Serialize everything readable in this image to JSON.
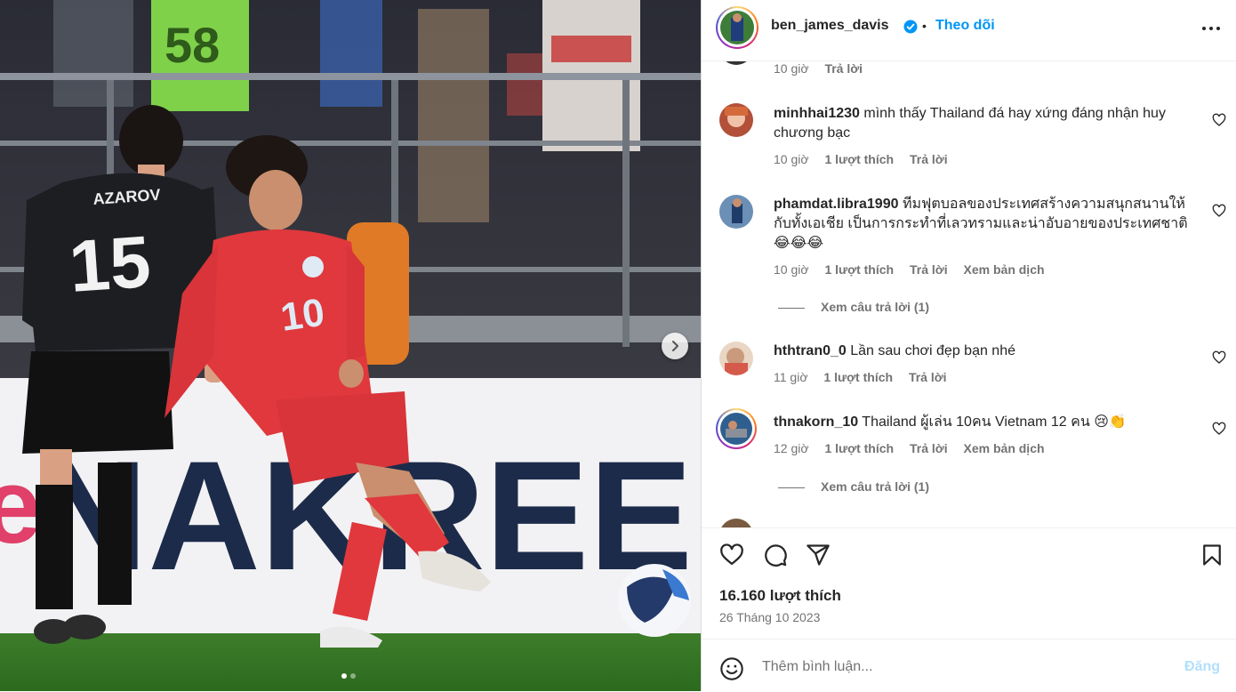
{
  "post": {
    "username": "ben_james_davis",
    "separator": "•",
    "follow_label": "Theo dõi",
    "likes": "16.160 lượt thích",
    "date": "26 Tháng 10 2023",
    "slides_total": 2,
    "slide_active": 1
  },
  "photo": {
    "player_left_name": "AZAROV",
    "player_left_number": "15",
    "player_right_number": "10",
    "stand_bib_number": "58",
    "banner_text": "NAKREE"
  },
  "comments": [
    {
      "user": "",
      "text": "",
      "time": "10 giờ",
      "likes": "",
      "reply": "Trả lời",
      "translate": ""
    },
    {
      "user": "minhhai1230",
      "text": "mình thấy Thailand đá hay xứng đáng nhận huy chương bạc",
      "time": "10 giờ",
      "likes": "1 lượt thích",
      "reply": "Trả lời",
      "translate": ""
    },
    {
      "user": "phamdat.libra1990",
      "text": "ทีมฟุตบอลของประเทศสร้างความสนุกสนานให้กับทั้งเอเชีย เป็นการกระทำที่เลวทรามและน่าอับอายของประเทศชาติ 😂😂😂",
      "time": "10 giờ",
      "likes": "1 lượt thích",
      "reply": "Trả lời",
      "translate": "Xem bản dịch",
      "view_replies": "Xem câu trả lời (1)"
    },
    {
      "user": "hthtran0_0",
      "text": "Lần sau chơi đẹp bạn nhé",
      "time": "11 giờ",
      "likes": "1 lượt thích",
      "reply": "Trả lời",
      "translate": ""
    },
    {
      "user": "thnakorn_10",
      "text": "Thailand ผู้เล่น 10คน Vietnam 12 คน 😢👏",
      "time": "12 giờ",
      "likes": "1 lượt thích",
      "reply": "Trả lời",
      "translate": "Xem bản dịch",
      "view_replies": "Xem câu trả lời (1)"
    }
  ],
  "add_comment": {
    "placeholder": "Thêm bình luận...",
    "post_label": "Đăng"
  },
  "colors": {
    "link_blue": "#0095f6",
    "post_disabled": "#b2dffc",
    "text_secondary": "#737373",
    "jersey_red": "#e0383c",
    "jersey_black": "#1d1e22"
  },
  "icons": [
    "verified-icon",
    "more-icon",
    "heart-icon",
    "comment-icon",
    "share-icon",
    "bookmark-icon",
    "emoji-icon",
    "chevron-right-icon"
  ]
}
